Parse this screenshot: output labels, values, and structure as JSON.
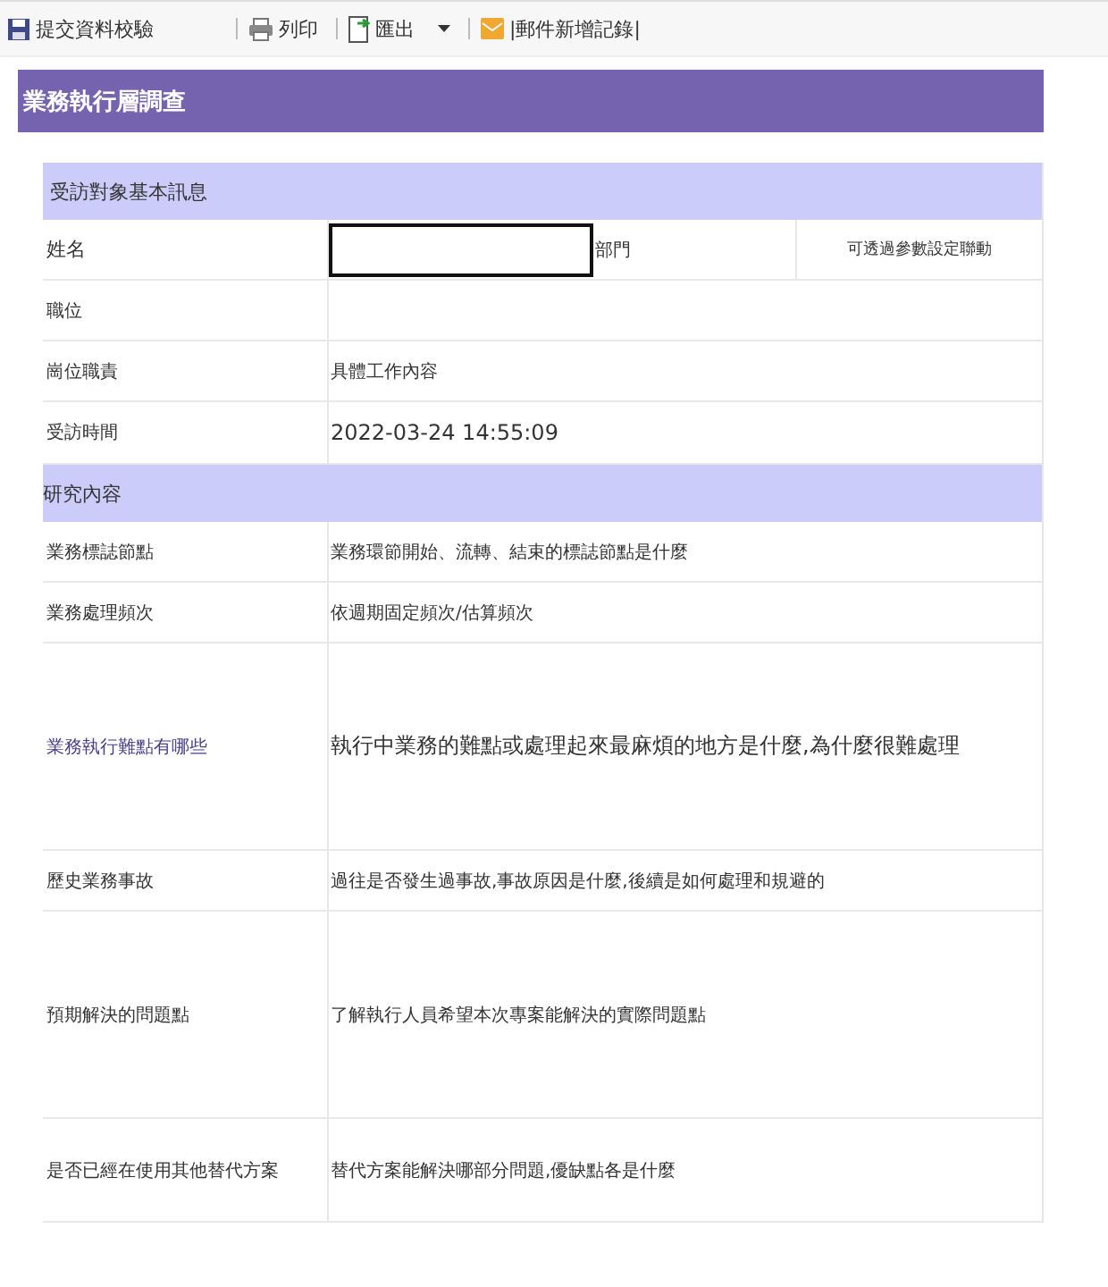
{
  "toolbar": [
    {
      "kind": "save",
      "label": "提交資料校驗"
    },
    {
      "kind": "print",
      "label": "列印"
    },
    {
      "kind": "export",
      "label": "匯出",
      "dropdown": true
    },
    {
      "kind": "mail",
      "label": "|郵件新增記錄|"
    }
  ],
  "form": {
    "title": "業務執行層調查",
    "sections": [
      {
        "header": "受訪對象基本訊息",
        "rows": [
          {
            "kind": "name",
            "label": "姓名",
            "value": "",
            "dept_label": "部門",
            "note": "可透過參數設定聯動"
          },
          {
            "kind": "field",
            "label": "職位"
          },
          {
            "kind": "field",
            "label": "崗位職責",
            "value": "具體工作內容"
          },
          {
            "kind": "datetime",
            "label": "受訪時間",
            "value": "2022-03-24 14:55:09"
          }
        ]
      },
      {
        "header": "研究內容",
        "rows": [
          {
            "kind": "field",
            "label": "業務標誌節點",
            "value": "業務環節開始、流轉、結束的標誌節點是什麼"
          },
          {
            "kind": "field",
            "label": "業務處理頻次",
            "value": "依週期固定頻次/估算頻次"
          },
          {
            "kind": "tall_field",
            "label": "業務執行難點有哪些",
            "value": "執行中業務的難點或處理起來最麻煩的地方是什麼,為什麼很難處理"
          },
          {
            "kind": "field",
            "label": "歷史業務事故",
            "value": "過往是否發生過事故,事故原因是什麼,後續是如何處理和規避的"
          },
          {
            "kind": "tall_field",
            "label": "預期解決的問題點",
            "value": "了解執行人員希望本次專案能解決的實際問題點"
          },
          {
            "kind": "medium_field",
            "label": "是否已經在使用其他替代方案",
            "value": "替代方案能解決哪部分問題,優缺點各是什麼"
          }
        ]
      }
    ]
  }
}
